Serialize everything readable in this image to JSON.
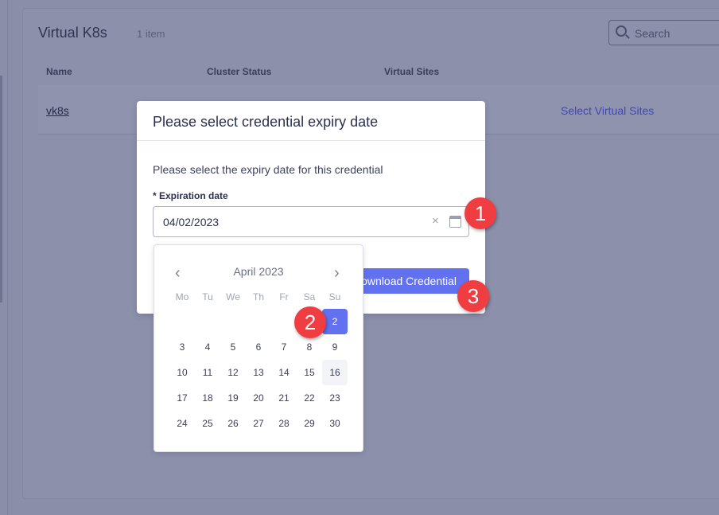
{
  "page": {
    "title": "Virtual K8s",
    "count": "1 item",
    "search_placeholder": "Search",
    "columns": [
      "Name",
      "Cluster Status",
      "Virtual Sites"
    ],
    "row": {
      "name": "vk8s",
      "action": "Select Virtual Sites"
    }
  },
  "modal": {
    "title": "Please select credential expiry date",
    "description": "Please select the expiry date for this credential",
    "field_label": "* Expiration date",
    "value": "04/02/2023",
    "clear": "×",
    "download_label": "Download Credential"
  },
  "calendar": {
    "month": "April 2023",
    "prev": "‹",
    "next": "›",
    "weekdays": [
      "Mo",
      "Tu",
      "We",
      "Th",
      "Fr",
      "Sa",
      "Su"
    ],
    "selected_day": 2,
    "today": 16,
    "first_weekday_index": 5,
    "days_in_month": 30
  },
  "badges": [
    "1",
    "2",
    "3"
  ],
  "colors": {
    "accent": "#6271f0",
    "badge": "#ef3d42"
  }
}
